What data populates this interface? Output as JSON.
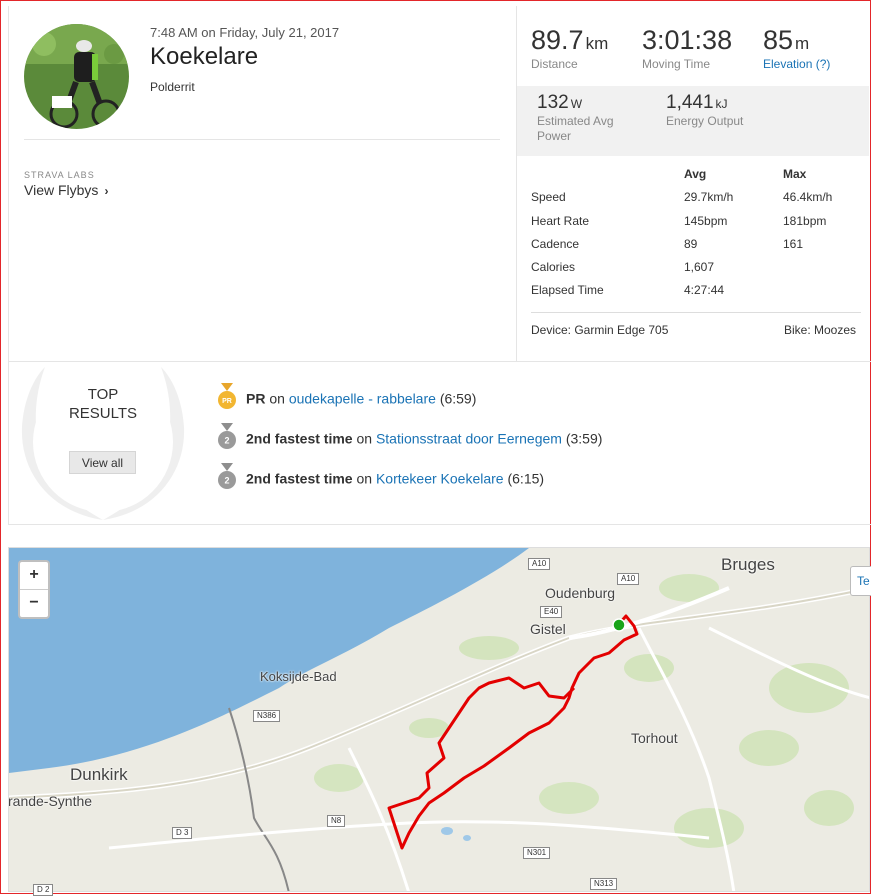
{
  "activity": {
    "datetime": "7:48 AM on Friday, July 21, 2017",
    "title": "Koekelare",
    "description": "Polderrit",
    "labs_label": "STRAVA LABS",
    "flybys_label": "View Flybys"
  },
  "stats": {
    "distance": {
      "value": "89.7",
      "unit": "km",
      "label": "Distance"
    },
    "moving_time": {
      "value": "3:01:38",
      "label": "Moving Time"
    },
    "elevation": {
      "value": "85",
      "unit": "m",
      "label": "Elevation (?)"
    },
    "power": {
      "value": "132",
      "unit": "W",
      "label_line1": "Estimated Avg",
      "label_line2": "Power"
    },
    "energy": {
      "value": "1,441",
      "unit": "kJ",
      "label": "Energy Output"
    }
  },
  "table": {
    "avg_header": "Avg",
    "max_header": "Max",
    "rows": [
      {
        "label": "Speed",
        "avg": "29.7km/h",
        "max": "46.4km/h"
      },
      {
        "label": "Heart Rate",
        "avg": "145bpm",
        "max": "181bpm"
      },
      {
        "label": "Cadence",
        "avg": "89",
        "max": "161"
      },
      {
        "label": "Calories",
        "avg": "1,607",
        "max": ""
      },
      {
        "label": "Elapsed Time",
        "avg": "4:27:44",
        "max": ""
      }
    ],
    "device": "Device: Garmin Edge 705",
    "bike": "Bike: Moozes"
  },
  "results": {
    "heading_line1": "TOP",
    "heading_line2": "RESULTS",
    "view_all": "View all",
    "items": [
      {
        "medal": "PR",
        "achievement": "PR",
        "on": "on",
        "segment": "oudekapelle - rabbelare",
        "time": "(6:59)"
      },
      {
        "medal": "2",
        "achievement": "2nd fastest time",
        "on": "on",
        "segment": "Stationsstraat door Eernegem",
        "time": "(3:59)"
      },
      {
        "medal": "2",
        "achievement": "2nd fastest time",
        "on": "on",
        "segment": "Kortekeer Koekelare",
        "time": "(6:15)"
      }
    ]
  },
  "map": {
    "zoom_in": "+",
    "zoom_out": "−",
    "labels": {
      "bruges": "Bruges",
      "oudenburg": "Oudenburg",
      "gistel": "Gistel",
      "koksijde": "Koksijde-Bad",
      "torhout": "Torhout",
      "dunkirk": "Dunkirk",
      "grande_synthe": "rande-Synthe"
    },
    "roads": {
      "a10a": "A10",
      "a10b": "A10",
      "e40": "E40",
      "n386": "N386",
      "d3": "D 3",
      "n8": "N8",
      "n301": "N301",
      "n313": "N313",
      "d2": "D 2"
    },
    "control_label": "Te",
    "route_color": "#e30000",
    "sea_color": "#7fb3dc",
    "land_color": "#ecebe3"
  }
}
